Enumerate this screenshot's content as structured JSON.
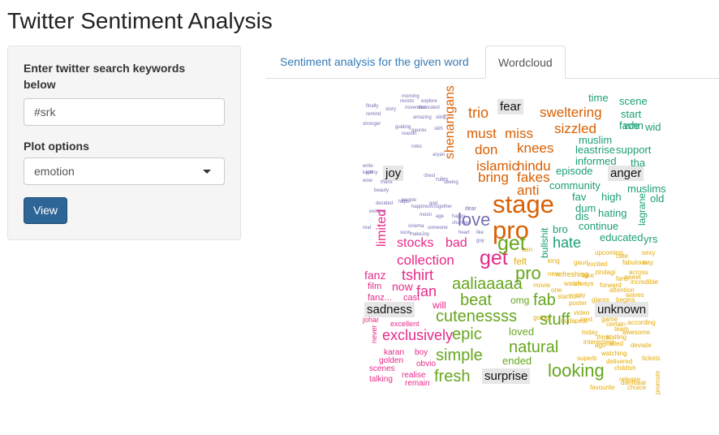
{
  "app": {
    "title": "Twitter Sentiment Analysis"
  },
  "sidebar": {
    "search_label": "Enter twitter search keywords below",
    "search_value": "#srk",
    "plot_label": "Plot options",
    "plot_value": "emotion",
    "view_label": "View"
  },
  "tabs": [
    {
      "label": "Sentiment analysis for the given word",
      "active": false
    },
    {
      "label": "Wordcloud",
      "active": true
    }
  ],
  "wordcloud": {
    "categories": [
      "fear",
      "joy",
      "anger",
      "sadness",
      "unknown",
      "surprise"
    ],
    "colors": {
      "fear": "#d95f02",
      "joy": "#7570b3",
      "anger": "#1b9e77",
      "sadness": "#e7298a",
      "unknown": "#e6ab02",
      "surprise": "#66a61e",
      "label_bg": "#e6e6e6"
    },
    "words": {
      "fear": [
        "shenanigans",
        "trio",
        "must",
        "miss",
        "sizzled",
        "sweltering",
        "don",
        "knees",
        "islamic",
        "hindu",
        "bring",
        "fakes",
        "anti",
        "stage",
        "pro"
      ],
      "joy": [
        "love",
        "morning",
        "resists",
        "explore",
        "november",
        "decorated",
        "amazing",
        "siklip",
        "guiding",
        "reason",
        "gaurav",
        "sikh",
        "roles",
        "aryan",
        "chest",
        "rules",
        "seeing",
        "people",
        "god",
        "happiness",
        "together",
        "moon",
        "age",
        "happy",
        "dear",
        "changed",
        "someone",
        "heart",
        "like",
        "guy",
        "cinema",
        "soon",
        "makeJoy",
        "exciting",
        "decided",
        "https",
        "beauty",
        "thanx",
        "johny",
        "finally",
        "stronger",
        "remind",
        "story",
        "write",
        "kajol",
        "wow",
        "real"
      ],
      "anger": [
        "time",
        "scene",
        "start",
        "whn",
        "wid",
        "face",
        "muslim",
        "rise",
        "support",
        "least",
        "informed",
        "tha",
        "episode",
        "community",
        "muslims",
        "high",
        "fav",
        "dum",
        "hating",
        "dis",
        "bro",
        "lagrane",
        "old",
        "continue",
        "educated",
        "yrs",
        "hate",
        "bullshit"
      ],
      "sadness": [
        "limited",
        "stocks",
        "bad",
        "collection",
        "get",
        "fanz",
        "tshirt",
        "now",
        "fan",
        "film",
        "fanz...",
        "cast",
        "will",
        "johar",
        "excellent",
        "exclusively",
        "never",
        "karan",
        "boy",
        "golden",
        "obvio",
        "scenes",
        "realise",
        "talking",
        "remain"
      ],
      "unknown": [
        "felt",
        "can",
        "king",
        "gauri",
        "excited",
        "fabulous",
        "way",
        "upcoming",
        "cute",
        "sexy",
        "new",
        "take",
        "always",
        "zindagi",
        "fans",
        "watch",
        "movie",
        "one",
        "cay",
        "refreshing",
        "forward",
        "incredible",
        "attention",
        "waves",
        "across",
        "poster",
        "sweet",
        "begins",
        "startfilm",
        "video",
        "budapest",
        "next",
        "game",
        "according",
        "certain",
        "team",
        "stalling",
        "today",
        "called",
        "awesome",
        "think",
        "ago",
        "deviate",
        "interesting",
        "watching",
        "delivered",
        "superb",
        "childish",
        "release",
        "promote",
        "dambaar",
        "favourite",
        "choice",
        "going",
        "glares",
        "tickets"
      ],
      "surprise": [
        "pro",
        "get",
        "aaliaaaaa",
        "beat",
        "omg",
        "fab",
        "cutenessss",
        "stuff",
        "epic",
        "loved",
        "natural",
        "simple",
        "ended",
        "looking",
        "fresh"
      ]
    }
  }
}
